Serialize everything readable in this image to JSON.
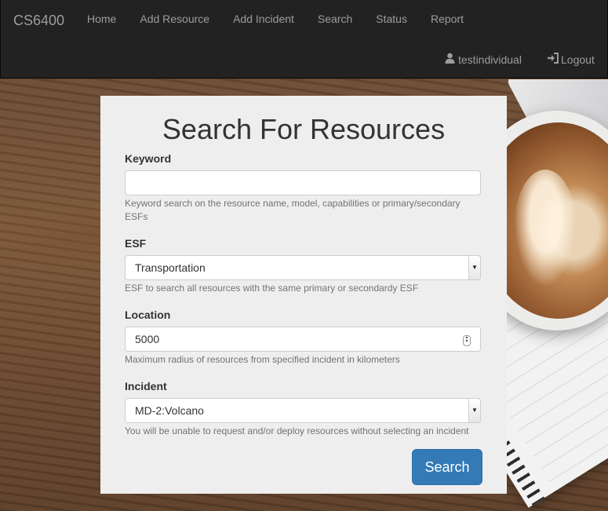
{
  "navbar": {
    "brand": "CS6400",
    "links": [
      "Home",
      "Add Resource",
      "Add Incident",
      "Search",
      "Status",
      "Report"
    ],
    "user": "testindividual",
    "logout": "Logout"
  },
  "form": {
    "title": "Search For Resources",
    "keyword": {
      "label": "Keyword",
      "value": "",
      "help": "Keyword search on the resource name, model, capabilities or primary/secondary ESFs"
    },
    "esf": {
      "label": "ESF",
      "value": "Transportation",
      "help": "ESF to search all resources with the same primary or secondardy ESF"
    },
    "location": {
      "label": "Location",
      "value": "5000",
      "help": "Maximum radius of resources from specified incident in kilometers"
    },
    "incident": {
      "label": "Incident",
      "value": "MD-2:Volcano",
      "help": "You will be unable to request and/or deploy resources without selecting an incident"
    },
    "submit": "Search"
  },
  "colors": {
    "navbar_bg": "#222222",
    "nav_text": "#9d9d9d",
    "primary": "#337ab7",
    "panel_bg": "#eeeeee"
  },
  "icons": {
    "user": "user-icon",
    "logout": "log-in-icon"
  }
}
